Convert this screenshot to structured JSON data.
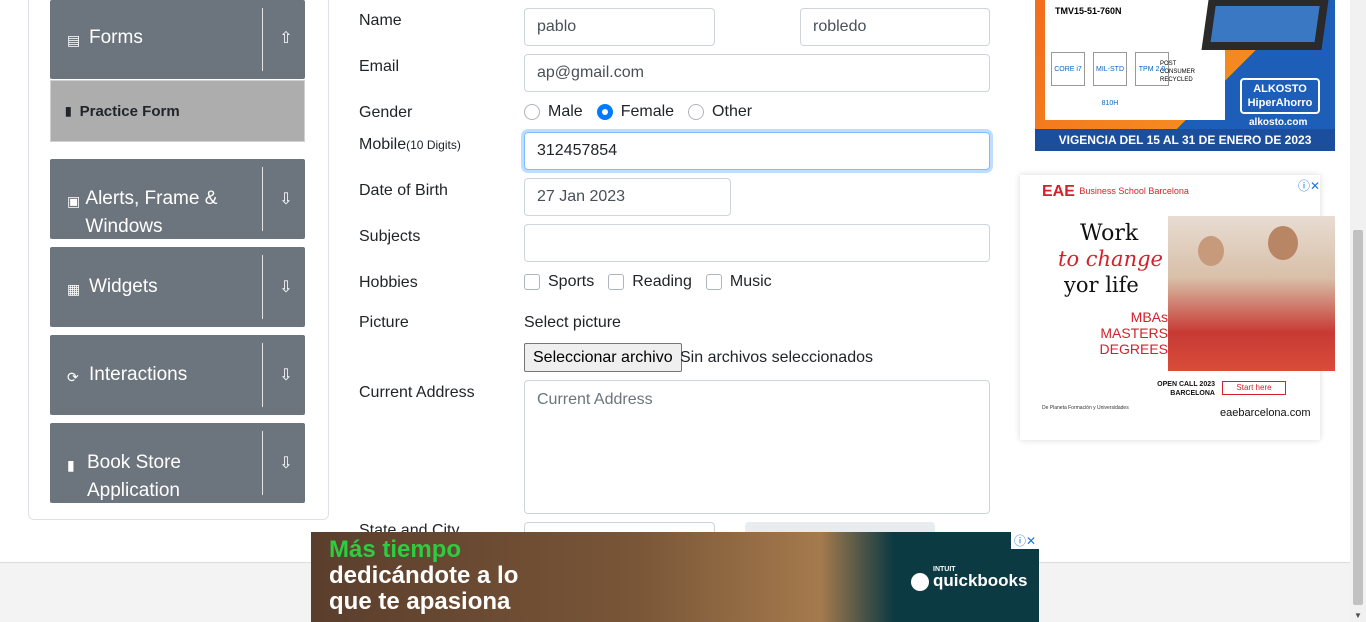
{
  "sidebar": {
    "forms": {
      "label": "Forms",
      "icon": "document-icon"
    },
    "practice_form": {
      "label": "Practice Form"
    },
    "alerts": {
      "label": "Alerts, Frame & Windows"
    },
    "widgets": {
      "label": "Widgets"
    },
    "interactions": {
      "label": "Interactions"
    },
    "book_store": {
      "label": "Book Store Application"
    }
  },
  "form": {
    "name_label": "Name",
    "first_name": "pablo",
    "last_name": "robledo",
    "email_label": "Email",
    "email": "ap@gmail.com",
    "gender_label": "Gender",
    "gender_options": [
      "Male",
      "Female",
      "Other"
    ],
    "gender_selected": "Female",
    "mobile_label": "Mobile",
    "mobile_hint": "(10 Digits)",
    "mobile": "312457854",
    "dob_label": "Date of Birth",
    "dob": "27 Jan 2023",
    "subjects_label": "Subjects",
    "subjects": "",
    "hobbies_label": "Hobbies",
    "hobbies": [
      "Sports",
      "Reading",
      "Music"
    ],
    "picture_label": "Picture",
    "select_picture": "Select picture",
    "file_button": "Seleccionar archivo",
    "file_status": "Sin archivos seleccionados",
    "address_label": "Current Address",
    "address_placeholder": "Current Address",
    "state_label": "State and City"
  },
  "ads": {
    "top": {
      "model": "TMV15-51-760N",
      "brand": "ALKOSTO",
      "brand_sub": "HiperAhorro",
      "url": "alkosto.com",
      "validity": "VIGENCIA DEL 15 AL 31 DE ENERO DE 2023",
      "intel": "CORE i7",
      "milstd": "MIL-STD 810H",
      "tpm": "TPM 2.0",
      "recycled": "POST CONSUMER RECYCLED"
    },
    "eae": {
      "logo": "EAE",
      "logo_sub": "Business School Barcelona",
      "line1": "Work",
      "line2": "to change",
      "line3": "yor life",
      "degrees": "MBAs MASTERS DEGREES",
      "open_call": "OPEN CALL 2023 BARCELONA",
      "start": "Start here",
      "site": "eaebarcelona.com",
      "pf": "De Planeta Formación y Universidades"
    },
    "bottom": {
      "line1": "Más tiempo",
      "line2": "dedicándote a lo",
      "line3": "que te apasiona",
      "brand_top": "INTUIT",
      "brand": "quickbooks"
    }
  }
}
